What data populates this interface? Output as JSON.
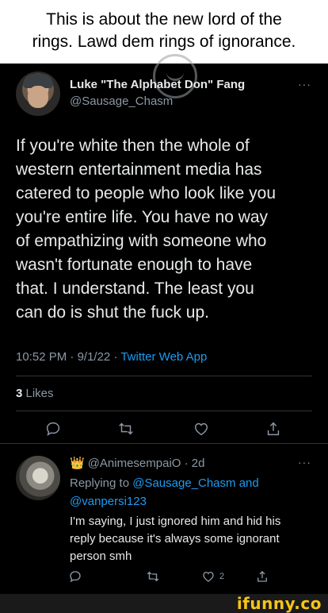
{
  "caption": {
    "line1": "This is about the new lord of the",
    "line2": "rings. Lawd dem rings of ignorance."
  },
  "main_tweet": {
    "display_name": "Luke \"The Alphabet Don\" Fang",
    "handle": "@Sausage_Chasm",
    "text": "If you're white then the whole of\nwestern entertainment media has\ncatered to people who look like you\nyou're entire life. You have no way\nof empathizing with someone who\nwasn't fortunate enough to have\nthat. I understand. The least you\ncan do is shut the fuck up.",
    "time": "10:52 PM",
    "date": "9/1/22",
    "separator": " · ",
    "app": "Twitter Web App",
    "likes_count": "3",
    "likes_label": " Likes",
    "more": "···"
  },
  "reply": {
    "badge": "👑",
    "handle": "@AnimesempaiO",
    "age": "· 2d",
    "replying_prefix": "Replying to ",
    "replying_to_1": "@Sausage_Chasm",
    "replying_and": " and",
    "replying_to_2": "@vanpersi123",
    "text": "I'm saying, I just ignored him and hid his reply because it's always some ignorant person smh",
    "like_count": "2",
    "more": "···"
  },
  "footer": {
    "brand": "ifunny.co"
  },
  "colors": {
    "accent": "#1d9bf0",
    "muted": "#8b98a5",
    "background": "#000000",
    "brand": "#f5c518"
  }
}
